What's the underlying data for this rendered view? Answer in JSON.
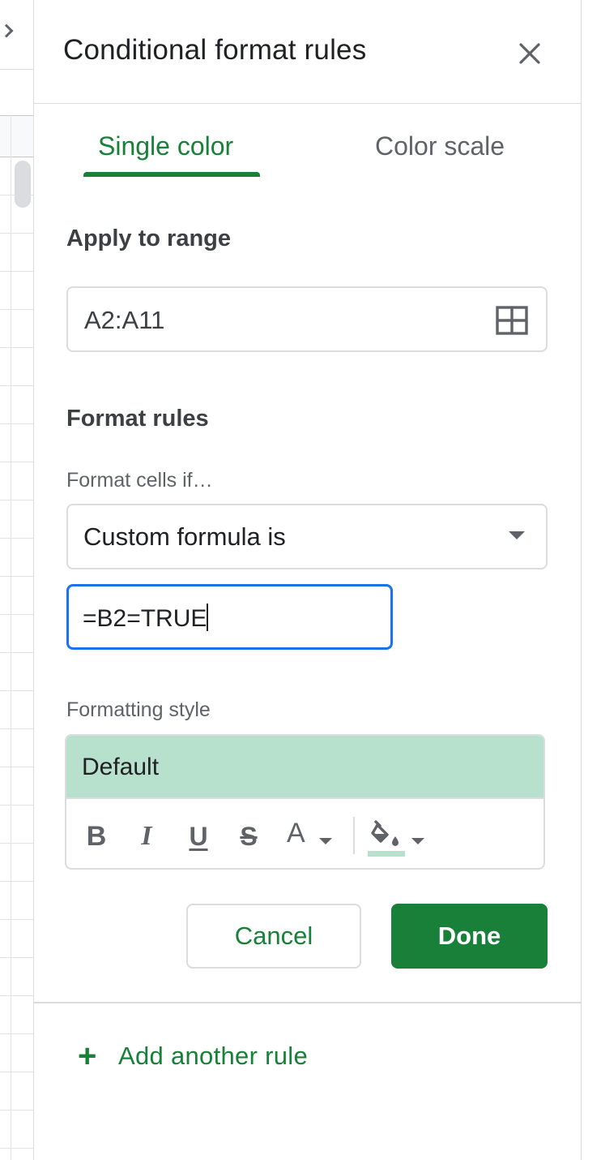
{
  "panel": {
    "title": "Conditional format rules",
    "close_icon": "close-icon"
  },
  "tabs": [
    {
      "label": "Single color",
      "active": true
    },
    {
      "label": "Color scale",
      "active": false
    }
  ],
  "apply_to_range": {
    "heading": "Apply to range",
    "value": "A2:A11",
    "icon": "grid-select-icon"
  },
  "format_rules": {
    "heading": "Format rules",
    "condition_label": "Format cells if…",
    "condition_value": "Custom formula is",
    "formula_value": "=B2=TRUE"
  },
  "formatting_style": {
    "label": "Formatting style",
    "preview_text": "Default",
    "preview_color": "#b7e1cd",
    "toolbar": {
      "bold": "B",
      "italic": "I",
      "underline": "U",
      "strikethrough": "S",
      "text_color": "A"
    }
  },
  "actions": {
    "cancel": "Cancel",
    "done": "Done"
  },
  "add_rule": {
    "plus": "+",
    "label": "Add another rule"
  },
  "colors": {
    "accent_green": "#188038",
    "focus_blue": "#1a73e8",
    "border_gray": "#dadce0"
  }
}
